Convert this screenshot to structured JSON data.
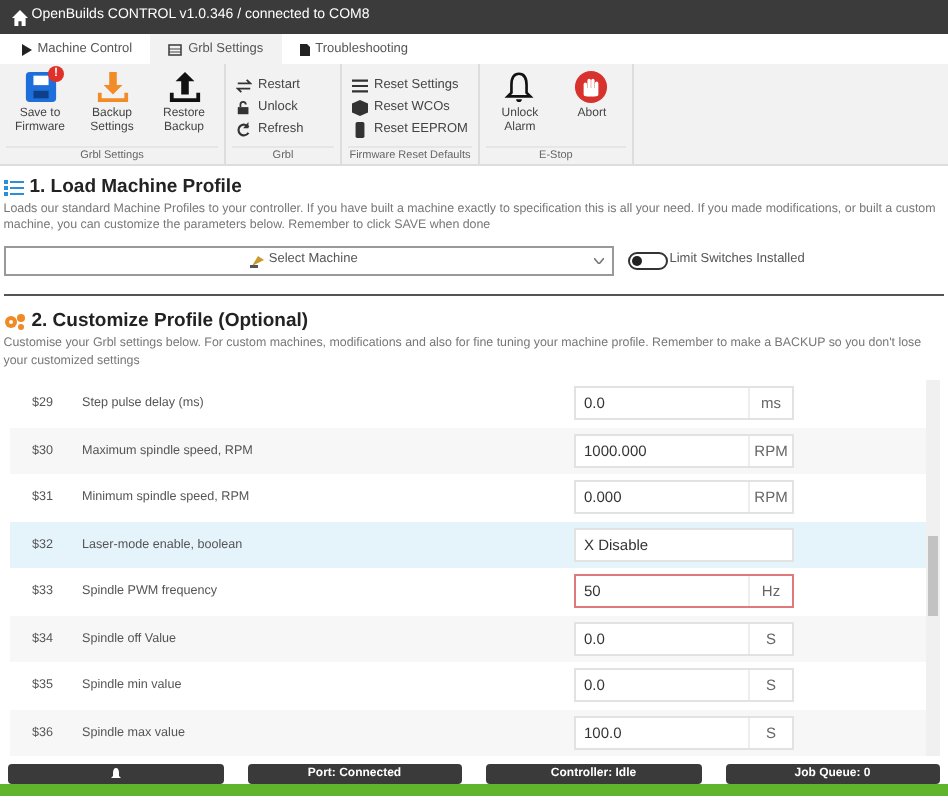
{
  "window": {
    "title": "OpenBuilds CONTROL v1.0.346 / connected to COM8"
  },
  "tabs": [
    {
      "label": "Machine Control",
      "selected": false
    },
    {
      "label": "Grbl Settings",
      "selected": true
    },
    {
      "label": "Troubleshooting",
      "selected": false
    }
  ],
  "ribbon": {
    "groups": [
      {
        "label": "Grbl Settings",
        "buttons": [
          {
            "kind": "large",
            "label": "Save to Firmware",
            "badge": "!"
          },
          {
            "kind": "large",
            "label": "Backup Settings"
          },
          {
            "kind": "large",
            "label": "Restore Backup"
          }
        ]
      },
      {
        "label": "Grbl",
        "buttons": [
          {
            "kind": "small",
            "label": "Restart"
          },
          {
            "kind": "small",
            "label": "Unlock"
          },
          {
            "kind": "small",
            "label": "Refresh"
          }
        ]
      },
      {
        "label": "Firmware Reset Defaults",
        "buttons": [
          {
            "kind": "small",
            "label": "Reset Settings"
          },
          {
            "kind": "small",
            "label": "Reset WCOs"
          },
          {
            "kind": "small",
            "label": "Reset EEPROM"
          }
        ]
      },
      {
        "label": "E-Stop",
        "buttons": [
          {
            "kind": "large",
            "label": "Unlock Alarm"
          },
          {
            "kind": "large",
            "label": "Abort"
          }
        ]
      }
    ]
  },
  "load_profile": {
    "title": "1. Load Machine Profile",
    "description": "Loads our standard Machine Profiles to your controller. If you have built a machine exactly to specification this is all your need. If you made modifications, or built a custom machine, you can customize the parameters below. Remember to click SAVE when done",
    "select": {
      "label": "Select Machine"
    },
    "toggle": {
      "label": "Limit Switches Installed",
      "on": false
    }
  },
  "customize": {
    "title": "2. Customize Profile (Optional)",
    "description": "Customise your Grbl settings below. For custom machines, modifications and also for fine tuning your machine profile. Remember to make a BACKUP so you don't lose your customized settings"
  },
  "settings": [
    {
      "code": "$29",
      "name": "Step pulse delay (ms)",
      "kind": "input",
      "value": "0.0",
      "unit": "ms",
      "selected": false,
      "invalid": false
    },
    {
      "code": "$30",
      "name": "Maximum spindle speed, RPM",
      "kind": "input",
      "value": "1000.000",
      "unit": "RPM",
      "selected": false,
      "invalid": false
    },
    {
      "code": "$31",
      "name": "Minimum spindle speed, RPM",
      "kind": "input",
      "value": "0.000",
      "unit": "RPM",
      "selected": false,
      "invalid": false
    },
    {
      "code": "$32",
      "name": "Laser-mode enable, boolean",
      "kind": "select",
      "value": "X Disable",
      "selected": true,
      "invalid": false
    },
    {
      "code": "$33",
      "name": "Spindle PWM frequency",
      "kind": "input",
      "value": "50",
      "unit": "Hz",
      "selected": false,
      "invalid": true
    },
    {
      "code": "$34",
      "name": "Spindle off Value",
      "kind": "input",
      "value": "0.0",
      "unit": "S",
      "selected": false,
      "invalid": false
    },
    {
      "code": "$35",
      "name": "Spindle min value",
      "kind": "input",
      "value": "0.0",
      "unit": "S",
      "selected": false,
      "invalid": false
    },
    {
      "code": "$36",
      "name": "Spindle max value",
      "kind": "input",
      "value": "100.0",
      "unit": "S",
      "selected": false,
      "invalid": false
    }
  ],
  "status_bar": {
    "items": [
      "Port: Connected",
      "Controller: Idle",
      "Job Queue: 0"
    ]
  }
}
